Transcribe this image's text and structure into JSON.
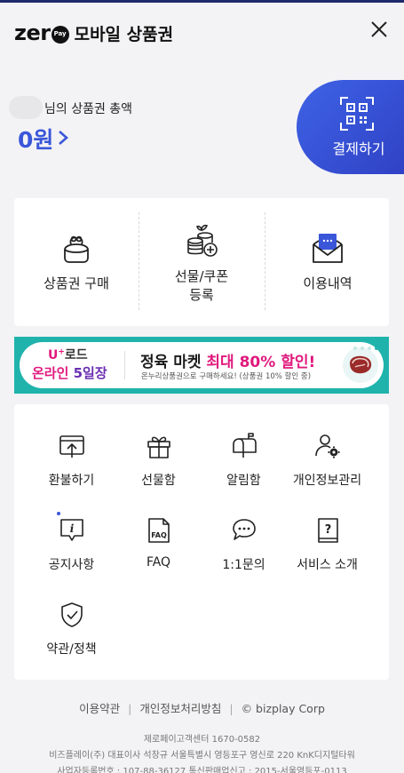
{
  "header": {
    "logo_word": "zer",
    "logo_pay": "Pay",
    "title": "모바일 상품권"
  },
  "balance": {
    "label": "님의 상품권 총액",
    "amount": "0원",
    "pay_label": "결제하기"
  },
  "main_menu": [
    {
      "label": "상품권 구매",
      "icon": "wallet-icon"
    },
    {
      "label": "선물/쿠폰\n등록",
      "icon": "coins-plus-icon"
    },
    {
      "label": "이용내역",
      "icon": "envelope-icon"
    }
  ],
  "banner": {
    "left_line1_prefix": "U",
    "left_line1_sup": "+",
    "left_line1_rest": "로드",
    "left_line2_a": "온라인 ",
    "left_line2_b": "5일장",
    "main_a": "정육 마켓 ",
    "main_b": "최대 80% 할인!",
    "sub": "온누리상품권으로 구매하세요! (상품권 10% 할인 중)"
  },
  "grid_menu": [
    {
      "label": "환불하기",
      "icon": "refund-icon"
    },
    {
      "label": "선물함",
      "icon": "gift-icon"
    },
    {
      "label": "알림함",
      "icon": "mailbox-icon"
    },
    {
      "label": "개인정보관리",
      "icon": "user-settings-icon"
    },
    {
      "label": "공지사항",
      "icon": "notice-icon"
    },
    {
      "label": "FAQ",
      "icon": "faq-icon"
    },
    {
      "label": "1:1문의",
      "icon": "chat-icon"
    },
    {
      "label": "서비스 소개",
      "icon": "question-book-icon"
    },
    {
      "label": "약관/정책",
      "icon": "shield-check-icon"
    }
  ],
  "footer": {
    "links": [
      "이용약관",
      "개인정보처리방침",
      "© bizplay Corp"
    ],
    "separator": "|",
    "call_center": "제로페이고객센터 1670-0582",
    "company": "비즈플레이(주) 대표이사 석창규 서울특별시 영등포구 영신로 220 KnK디지털타워",
    "registration": "사업자등록번호 : 107-88-36127 통신판매업신고 : 2015-서울영등포-0113"
  },
  "colors": {
    "accent": "#3a56d9",
    "pay_button": "#3e63e6",
    "banner_bg": "#1fb3ac",
    "banner_pink": "#e0197d"
  }
}
